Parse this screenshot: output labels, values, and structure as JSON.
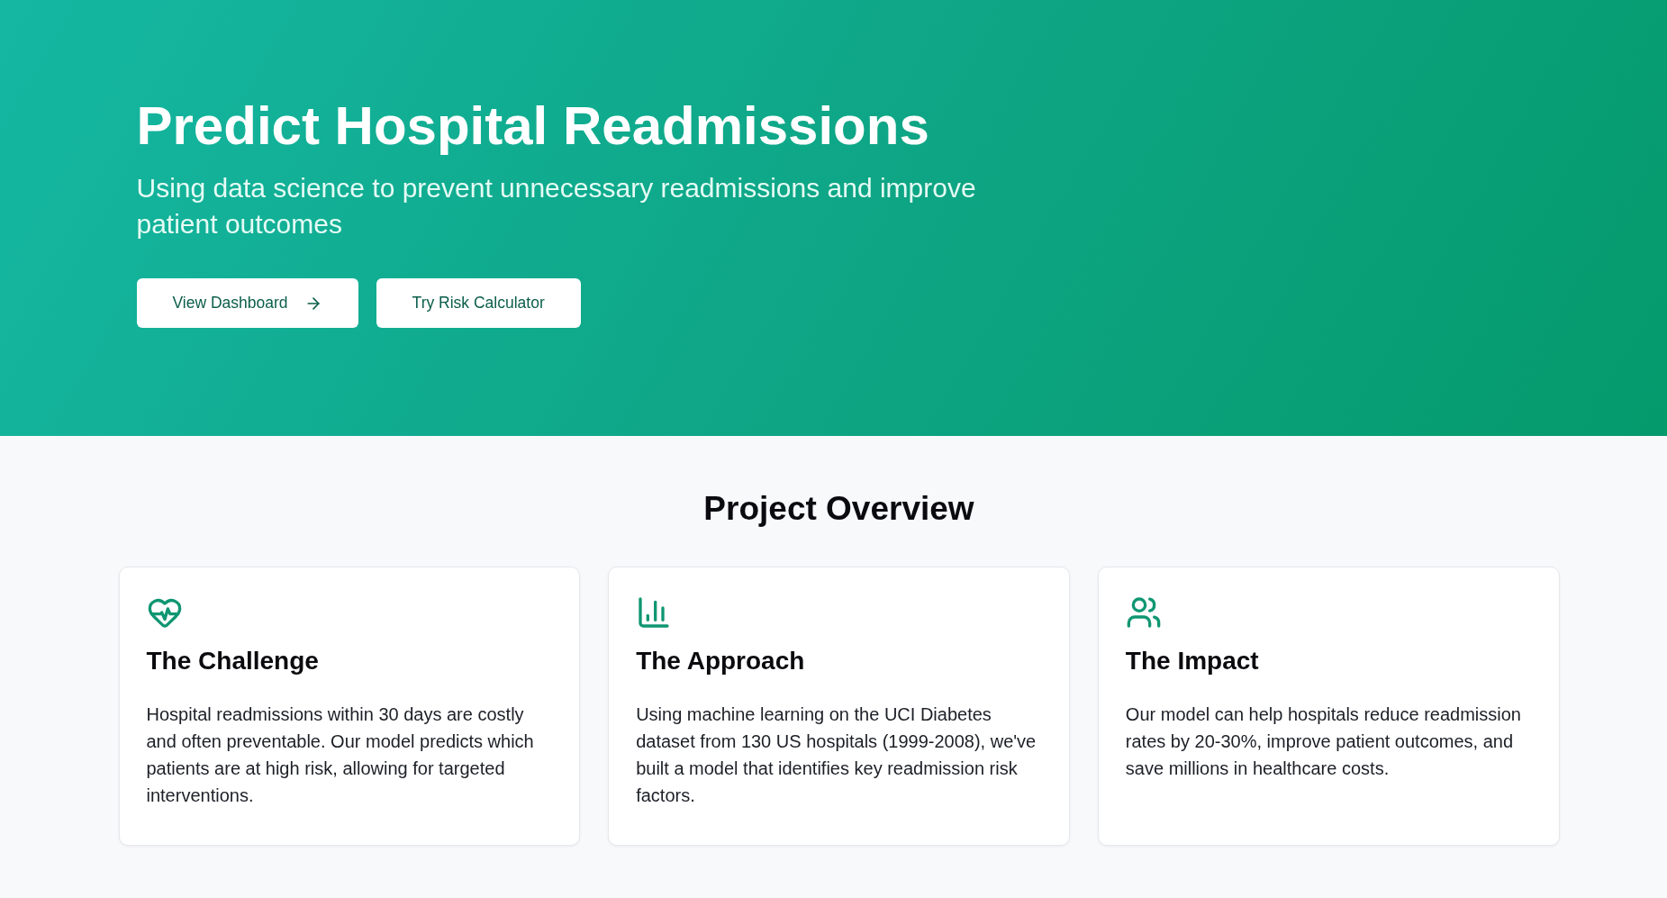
{
  "hero": {
    "title": "Predict Hospital Readmissions",
    "subtitle": "Using data science to prevent unnecessary readmissions and improve patient outcomes",
    "buttons": [
      {
        "label": "View Dashboard",
        "kind": "arrow"
      },
      {
        "label": "Try Risk Calculator",
        "kind": "plain"
      }
    ]
  },
  "overview": {
    "heading": "Project Overview",
    "cards": [
      {
        "title": "The Challenge",
        "text": "Hospital readmissions within 30 days are costly and often preventable. Our model predicts which patients are at high risk, allowing for targeted interventions."
      },
      {
        "title": "The Approach",
        "text": "Using machine learning on the UCI Diabetes dataset from 130 US hospitals (1999-2008), we've built a model that identifies key readmission risk factors."
      },
      {
        "title": "The Impact",
        "text": "Our model can help hospitals reduce readmission rates by 20-30%, improve patient outcomes, and save millions in healthcare costs."
      }
    ]
  }
}
